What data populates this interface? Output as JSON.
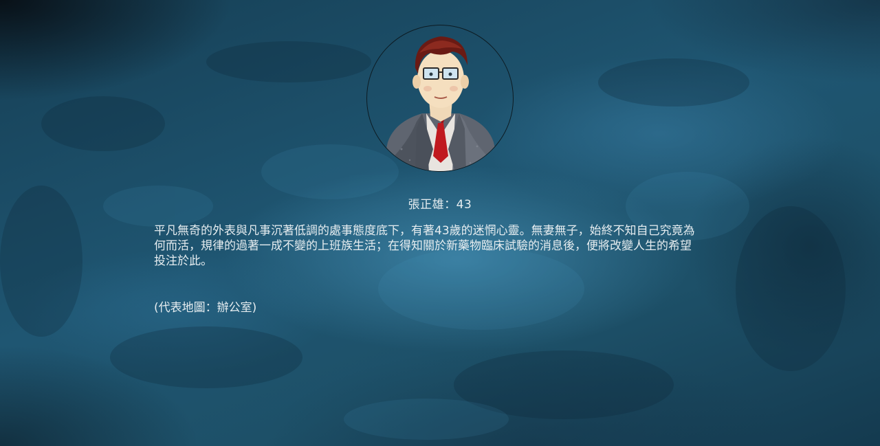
{
  "character": {
    "name_age": "張正雄：43",
    "bio_lines": [
      "平凡無奇的外表與凡事沉著低調的處事態度底下，有著43歲的迷惘心靈。無妻無子，始終不知自己究竟為",
      "何而活，規律的過著一成不變的上班族生活；在得知關於新藥物臨床試驗的消息後，便將改變人生的希望",
      "投注於此。"
    ],
    "map_note": "(代表地圖：辦公室)",
    "portrait_icon": "businessman-portrait"
  },
  "colors": {
    "background": "#1d4e66",
    "text": "#e6edf0",
    "tie": "#c0191f",
    "suit": "#5f6570"
  }
}
